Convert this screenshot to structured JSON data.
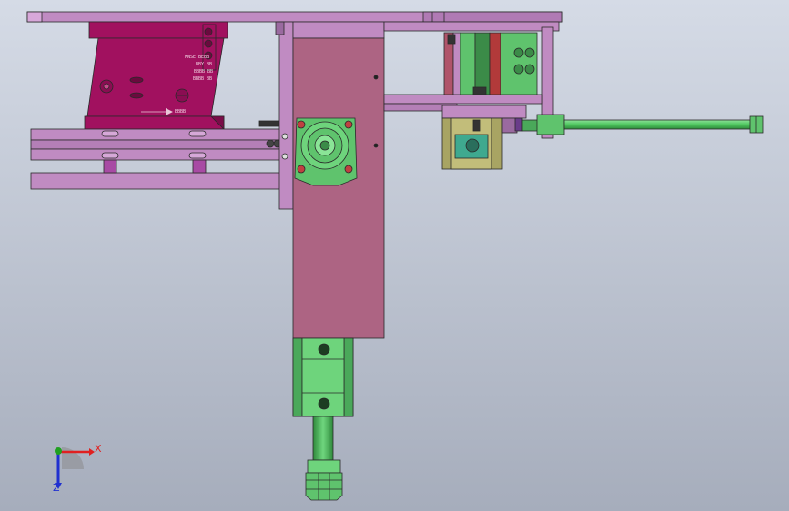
{
  "viewport": {
    "background_top": "#d5dbe6",
    "background_bottom": "#a6adbc"
  },
  "colors": {
    "frame_plate": "#c08bc2",
    "frame_plate_dark": "#9a6aa0",
    "block_body": "#ad6483",
    "block_body_dark": "#8a4a66",
    "bracket_magenta": "#a1115f",
    "cylinder_green": "#5fc36d",
    "cylinder_green_dark": "#3b8b48",
    "rod_green": "#4ec65e",
    "olive_block": "#a8a463",
    "teal_part": "#3fa98f",
    "rail_red": "#b23a3a",
    "outline": "#2a2a2a"
  },
  "engraving": {
    "plate_lines": [
      "MNSE BEBB",
      "BBY BB",
      "BBBB BB",
      "BBBB BB"
    ],
    "arrow_text": "BBBB"
  },
  "triad": {
    "x_label": "X",
    "z_label": "Z",
    "x_color": "#e02020",
    "y_color": "#20a020",
    "z_color": "#2030d0"
  }
}
